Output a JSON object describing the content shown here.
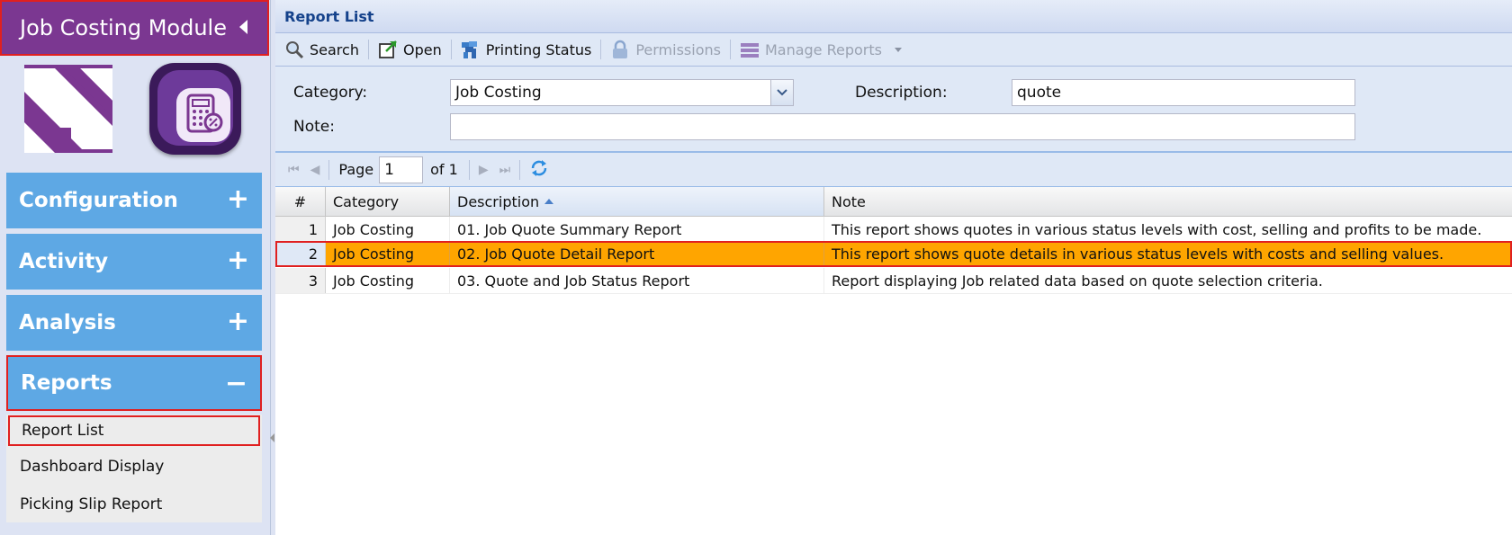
{
  "sidebar": {
    "module_title": "Job Costing Module",
    "sections": [
      {
        "label": "Configuration",
        "sign": "+"
      },
      {
        "label": "Activity",
        "sign": "+"
      },
      {
        "label": "Analysis",
        "sign": "+"
      },
      {
        "label": "Reports",
        "sign": "−"
      }
    ],
    "sub_items": [
      "Report List",
      "Dashboard Display",
      "Picking Slip Report"
    ]
  },
  "panel": {
    "title": "Report List"
  },
  "toolbar": {
    "search": "Search",
    "open": "Open",
    "printing_status": "Printing Status",
    "permissions": "Permissions",
    "manage_reports": "Manage Reports"
  },
  "filter": {
    "category_label": "Category:",
    "category_value": "Job Costing",
    "description_label": "Description:",
    "description_value": "quote",
    "note_label": "Note:",
    "note_value": ""
  },
  "pager": {
    "page_label": "Page",
    "page_value": "1",
    "of_label": "of 1"
  },
  "grid": {
    "columns": [
      "#",
      "Category",
      "Description",
      "Note"
    ],
    "rows": [
      {
        "num": "1",
        "category": "Job Costing",
        "description": "01. Job Quote Summary Report",
        "note": "This report shows quotes in various status levels with cost, selling and profits to be made."
      },
      {
        "num": "2",
        "category": "Job Costing",
        "description": "02. Job Quote Detail Report",
        "note": "This report shows quote details in various status levels with costs and selling values."
      },
      {
        "num": "3",
        "category": "Job Costing",
        "description": "03. Quote and Job Status Report",
        "note": "Report displaying Job related data based on quote selection criteria."
      }
    ]
  },
  "colors": {
    "accent_purple": "#7b3791",
    "section_blue": "#5ea8e4",
    "selected_row": "#ffa500",
    "highlight_red": "#e02020"
  }
}
